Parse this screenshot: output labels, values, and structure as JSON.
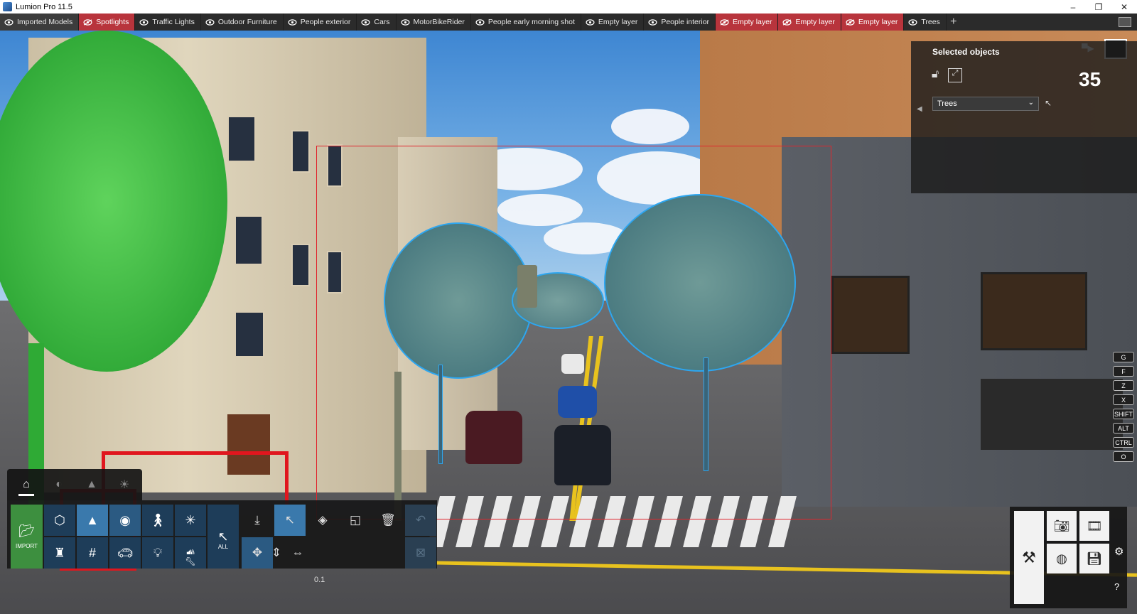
{
  "window": {
    "title": "Lumion Pro 11.5",
    "minimize": "–",
    "restore": "❐",
    "close": "✕"
  },
  "layers": [
    {
      "label": "Imported Models",
      "state": "active"
    },
    {
      "label": "Spotlights",
      "state": "hidden"
    },
    {
      "label": "Traffic Lights",
      "state": "visible"
    },
    {
      "label": "Outdoor Furniture",
      "state": "visible"
    },
    {
      "label": "People exterior",
      "state": "visible"
    },
    {
      "label": "Cars",
      "state": "visible"
    },
    {
      "label": "MotorBikeRider",
      "state": "visible"
    },
    {
      "label": "People early morning shot",
      "state": "visible"
    },
    {
      "label": "Empty layer",
      "state": "visible"
    },
    {
      "label": "People interior",
      "state": "visible"
    },
    {
      "label": "Empty layer",
      "state": "hidden"
    },
    {
      "label": "Empty layer",
      "state": "hidden"
    },
    {
      "label": "Empty layer",
      "state": "hidden"
    },
    {
      "label": "Trees",
      "state": "visible"
    }
  ],
  "add_layer": "+",
  "selection": {
    "heading": "Selected objects",
    "count": "35",
    "category": "Trees",
    "lock_icon": "lock-icon",
    "transform_icon": "resize-icon"
  },
  "shortcut_keys": [
    "G",
    "F",
    "Z",
    "X",
    "SHIFT",
    "ALT",
    "CTRL",
    "O"
  ],
  "toolbar": {
    "import_label": "IMPORT",
    "all_label": "ALL",
    "value": "0.1",
    "category_tabs": [
      "home-icon",
      "weather-icon",
      "landscape-icon",
      "light-icon"
    ]
  },
  "colors": {
    "layer_hidden": "#b8343c",
    "selection_box": "#e0262e",
    "tool_blue": "#2b5a82",
    "import_green": "#3d8f3f"
  }
}
